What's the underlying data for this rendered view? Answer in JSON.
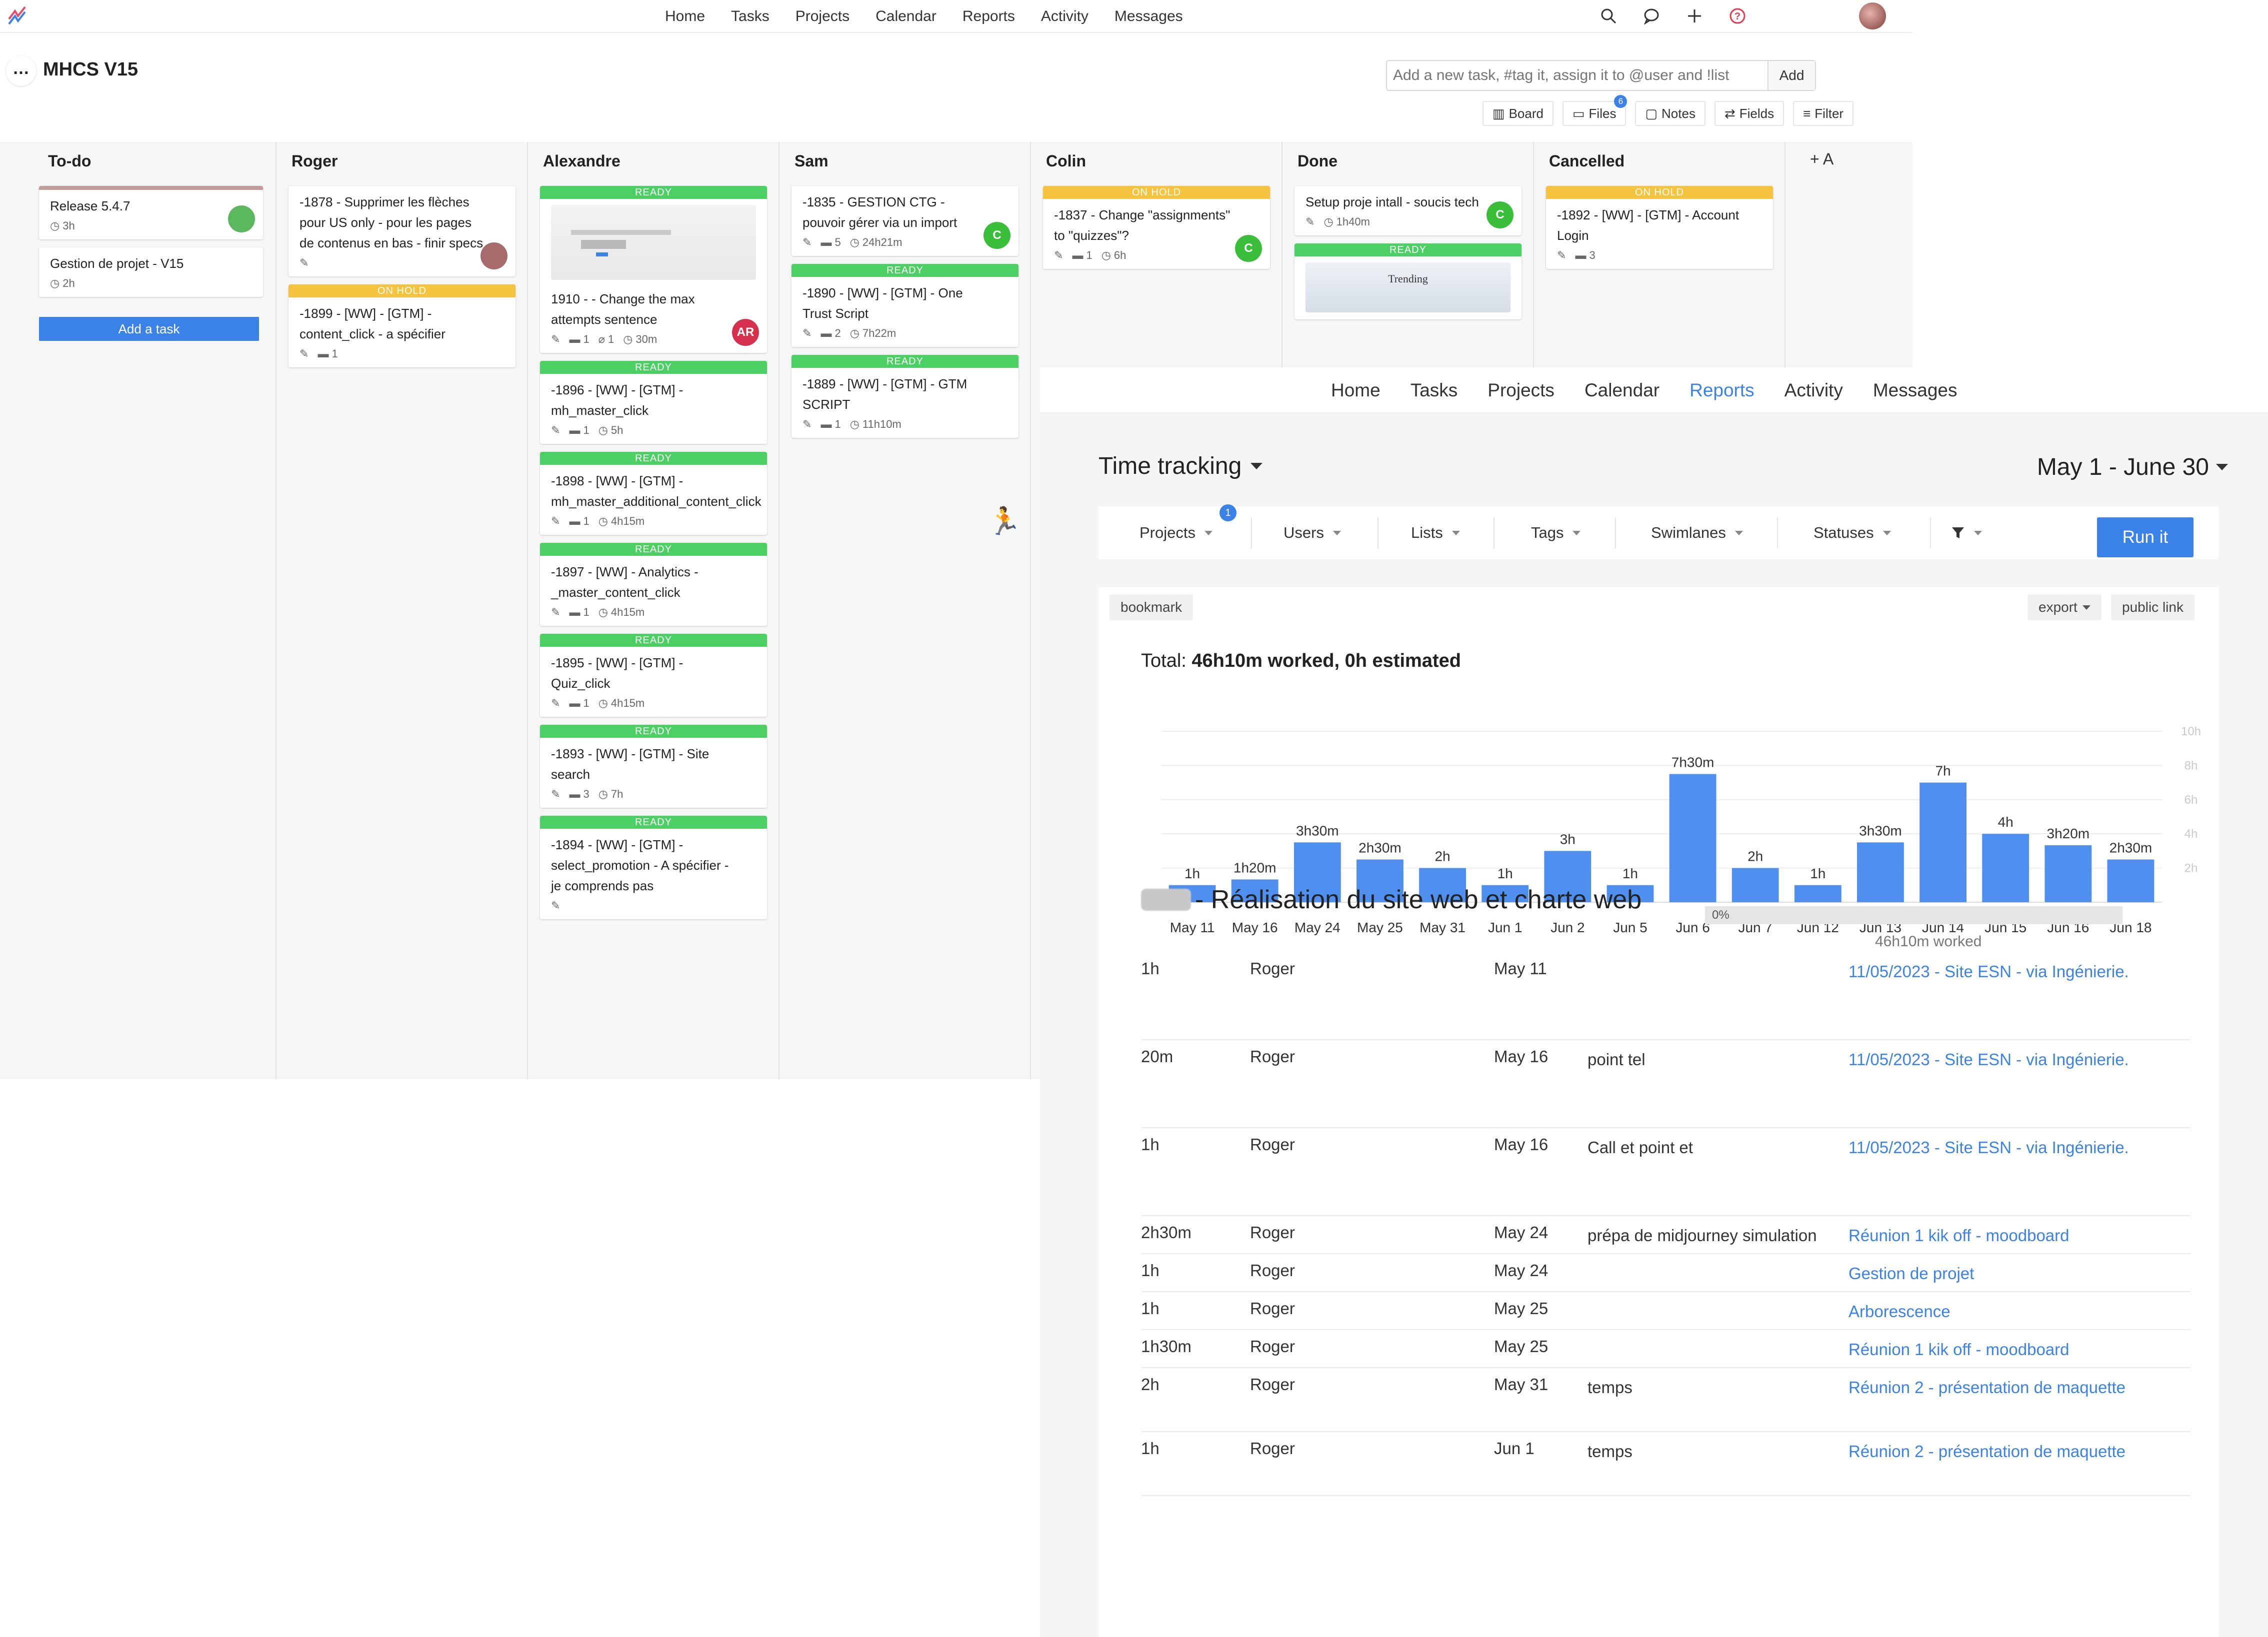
{
  "topnav": {
    "items": [
      "Home",
      "Tasks",
      "Projects",
      "Calendar",
      "Reports",
      "Activity",
      "Messages"
    ]
  },
  "project": {
    "title": "MHCS V15",
    "quick_add_placeholder": "Add a new task, #tag it, assign it to @user and !list",
    "quick_add_button": "Add",
    "tools": [
      {
        "label": "Board",
        "icon": "board-icon"
      },
      {
        "label": "Files",
        "icon": "folder-icon",
        "badge": "6"
      },
      {
        "label": "Notes",
        "icon": "notes-icon"
      },
      {
        "label": "Fields",
        "icon": "fields-icon"
      },
      {
        "label": "Filter",
        "icon": "filter-icon"
      }
    ]
  },
  "board": {
    "add_task_label": "Add a task",
    "add_column_label": "+ A",
    "columns": [
      {
        "title": "To-do",
        "cards": [
          {
            "title": "Release 5.4.7",
            "time": "3h",
            "avatar_color": "#5cb85c"
          },
          {
            "title": "Gestion de projet - V15",
            "time": "2h"
          }
        ]
      },
      {
        "title": "Roger",
        "cards": [
          {
            "title": "-1878 - Supprimer les flèches pour US only - pour les pages de contenus en bas - finir specs",
            "avatar_color": "#a86b6b"
          },
          {
            "tag": "ON HOLD",
            "title": "-1899 - [WW] - [GTM] - content_click - a spécifier",
            "comments": "1"
          }
        ]
      },
      {
        "title": "Alexandre",
        "cards": [
          {
            "tag": "READY",
            "title": "1910 - - Change the max attempts sentence",
            "comments": "1",
            "attachments": "1",
            "time": "30m",
            "avatar": "AR",
            "avatar_color": "#d6304c"
          },
          {
            "tag": "READY",
            "title": "-1896 - [WW] - [GTM] - mh_master_click",
            "comments": "1",
            "time": "5h"
          },
          {
            "tag": "READY",
            "title": "-1898 - [WW] - [GTM] - mh_master_additional_content_click",
            "comments": "1",
            "time": "4h15m"
          },
          {
            "tag": "READY",
            "title": "-1897 - [WW] - Analytics - _master_content_click",
            "comments": "1",
            "time": "4h15m"
          },
          {
            "tag": "READY",
            "title": "-1895 - [WW] - [GTM] - Quiz_click",
            "comments": "1",
            "time": "4h15m"
          },
          {
            "tag": "READY",
            "title": "-1893 - [WW] - [GTM] - Site search",
            "comments": "3",
            "time": "7h"
          },
          {
            "tag": "READY",
            "title": "-1894 - [WW] - [GTM] - select_promotion - A spécifier - je comprends pas"
          }
        ]
      },
      {
        "title": "Sam",
        "cards": [
          {
            "title": "-1835 - GESTION CTG - pouvoir gérer via un import",
            "comments": "5",
            "time": "24h21m",
            "avatar": "C",
            "avatar_color": "#3bbf3b"
          },
          {
            "tag": "READY",
            "title": "-1890 - [WW] - [GTM] - One Trust Script",
            "comments": "2",
            "time": "7h22m"
          },
          {
            "tag": "READY",
            "title": "-1889 - [WW] - [GTM] - GTM SCRIPT",
            "comments": "1",
            "time": "11h10m"
          }
        ]
      },
      {
        "title": "Colin",
        "cards": [
          {
            "tag": "ON HOLD",
            "title": "-1837 - Change \"assignments\" to \"quizzes\"?",
            "comments": "1",
            "time": "6h",
            "avatar": "C",
            "avatar_color": "#3bbf3b"
          }
        ]
      },
      {
        "title": "Done",
        "cards": [
          {
            "title": "Setup proje intall - soucis tech",
            "time": "1h40m",
            "avatar": "C",
            "avatar_color": "#3bbf3b"
          },
          {
            "tag": "READY",
            "title": "",
            "thumb_text": "Trending"
          }
        ]
      },
      {
        "title": "Cancelled",
        "cards": [
          {
            "tag": "ON HOLD",
            "title": "-1892 - [WW] - [GTM] - Account Login",
            "comments": "3"
          }
        ]
      }
    ]
  },
  "reports": {
    "nav": [
      "Home",
      "Tasks",
      "Projects",
      "Calendar",
      "Reports",
      "Activity",
      "Messages"
    ],
    "active_nav": "Reports",
    "title": "Time tracking",
    "date_range": "May 1 - June 30",
    "filters": [
      "Projects",
      "Users",
      "Lists",
      "Tags",
      "Swimlanes",
      "Statuses"
    ],
    "projects_badge": "1",
    "run_label": "Run it",
    "bookmark_label": "bookmark",
    "export_label": "export",
    "public_link_label": "public link",
    "total_prefix": "Total:",
    "total_value": "46h10m worked, 0h estimated",
    "project_name": "- Réalisation du site web et charte web",
    "progress_label": "0%",
    "progress_value": 0,
    "project_worked": "46h10m worked",
    "entries": [
      {
        "duration": "1h",
        "user": "Roger",
        "date": "May 11",
        "comment": "",
        "task": "11/05/2023 - Site ESN - via Ingénierie."
      },
      {
        "duration": "20m",
        "user": "Roger",
        "date": "May 16",
        "comment": "point tel",
        "task": "11/05/2023 - Site ESN - via Ingénierie."
      },
      {
        "duration": "1h",
        "user": "Roger",
        "date": "May 16",
        "comment": "Call et point et",
        "task": "11/05/2023 - Site ESN - via Ingénierie."
      },
      {
        "duration": "2h30m",
        "user": "Roger",
        "date": "May 24",
        "comment": "prépa de midjourney simulation",
        "task": "Réunion 1 kik off - moodboard"
      },
      {
        "duration": "1h",
        "user": "Roger",
        "date": "May 24",
        "comment": "",
        "task": "Gestion de projet"
      },
      {
        "duration": "1h",
        "user": "Roger",
        "date": "May 25",
        "comment": "",
        "task": "Arborescence"
      },
      {
        "duration": "1h30m",
        "user": "Roger",
        "date": "May 25",
        "comment": "",
        "task": "Réunion 1 kik off - moodboard"
      },
      {
        "duration": "2h",
        "user": "Roger",
        "date": "May 31",
        "comment": "temps",
        "task": "Réunion 2 - présentation de maquette"
      },
      {
        "duration": "1h",
        "user": "Roger",
        "date": "Jun 1",
        "comment": "temps",
        "task": "Réunion 2 - présentation de maquette"
      }
    ]
  },
  "chart_data": {
    "type": "bar",
    "categories": [
      "May 11",
      "May 16",
      "May 24",
      "May 25",
      "May 31",
      "Jun 1",
      "Jun 2",
      "Jun 5",
      "Jun 6",
      "Jun 7",
      "Jun 12",
      "Jun 13",
      "Jun 14",
      "Jun 15",
      "Jun 16",
      "Jun 18"
    ],
    "values": [
      1,
      1.333,
      3.5,
      2.5,
      2,
      1,
      3,
      1,
      7.5,
      2,
      1,
      3.5,
      7,
      4,
      3.333,
      2.5
    ],
    "labels": [
      "1h",
      "1h20m",
      "3h30m",
      "2h30m",
      "2h",
      "1h",
      "3h",
      "1h",
      "7h30m",
      "2h",
      "1h",
      "3h30m",
      "7h",
      "4h",
      "3h20m",
      "2h30m"
    ],
    "y_ticks": [
      "10h",
      "8h",
      "6h",
      "4h",
      "2h"
    ],
    "ylim": [
      0,
      10
    ],
    "color": "#4f8ff0",
    "grid": true
  }
}
